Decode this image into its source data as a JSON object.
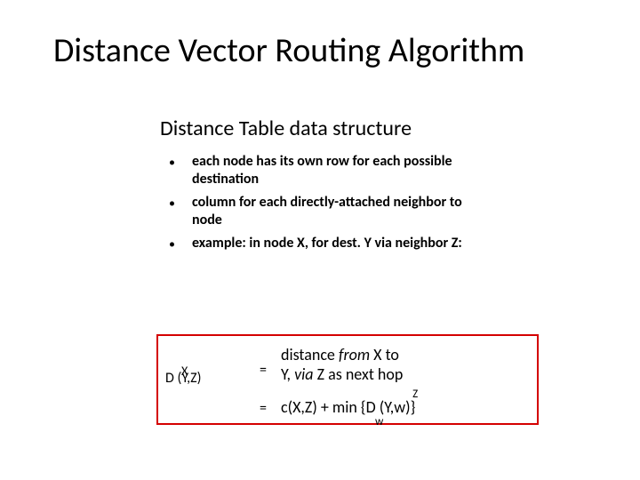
{
  "title": "Distance Vector Routing Algorithm",
  "subtitle": "Distance Table data structure",
  "bullets": [
    "each node has its own row for each possible destination",
    "column for each directly-attached neighbor to node",
    "example: in node X, for dest. Y via neighbor Z:"
  ],
  "formula": {
    "lhs_super": "X",
    "lhs_main": "D (Y,Z)",
    "eq": "=",
    "rhs1_line1": "distance ",
    "rhs1_line1_it": "from",
    "rhs1_line1_tail": " X to",
    "rhs1_line2_a": "Y, ",
    "rhs1_line2_it": "via",
    "rhs1_line2_b": " Z as next hop",
    "rhs2_a": "c(X,Z) + min {D (Y,w)}",
    "rhs2_sup": "Z",
    "min_sub": "w"
  }
}
